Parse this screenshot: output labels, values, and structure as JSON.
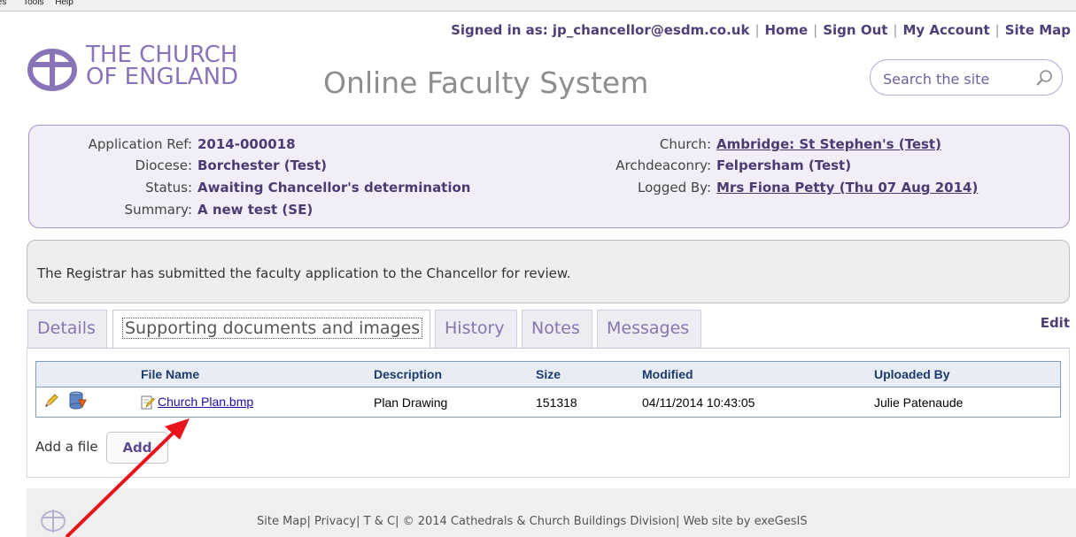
{
  "browser_menu": {
    "items": [
      "tes",
      "Tools",
      "Help"
    ]
  },
  "user_nav": {
    "signed_in": "Signed in as: jp_chancellor@esdm.co.uk",
    "home": "Home",
    "sign_out": "Sign Out",
    "my_account": "My Account",
    "site_map": "Site Map"
  },
  "logo": {
    "line1": "THE CHURCH",
    "line2": "OF ENGLAND"
  },
  "site_title": "Online Faculty System",
  "search": {
    "placeholder": "Search the site",
    "icon": "search-icon"
  },
  "application": {
    "ref_label": "Application Ref:",
    "ref": "2014-000018",
    "diocese_label": "Diocese:",
    "diocese": "Borchester (Test)",
    "status_label": "Status:",
    "status": "Awaiting Chancellor's determination",
    "summary_label": "Summary:",
    "summary": "A new test (SE)",
    "church_label": "Church:",
    "church": "Ambridge: St Stephen's (Test)",
    "archdeaconry_label": "Archdeaconry:",
    "archdeaconry": "Felpersham (Test)",
    "logged_by_label": "Logged By:",
    "logged_by": "Mrs Fiona Petty (Thu 07 Aug 2014)"
  },
  "message": "The Registrar has submitted the faculty application to the Chancellor for review.",
  "tabs": [
    {
      "label": "Details"
    },
    {
      "label": "Supporting documents and images"
    },
    {
      "label": "History"
    },
    {
      "label": "Notes"
    },
    {
      "label": "Messages"
    }
  ],
  "edit_label": "Edit",
  "file_table": {
    "headers": [
      "File Name",
      "Description",
      "Size",
      "Modified",
      "Uploaded By"
    ],
    "rows": [
      {
        "file_name": "Church Plan.bmp",
        "description": "Plan Drawing",
        "size": "151318",
        "modified": "04/11/2014 10:43:05",
        "uploaded_by": "Julie Patenaude"
      }
    ]
  },
  "add_file": {
    "label": "Add a file",
    "button": "Add"
  },
  "footer": {
    "site_map": "Site Map",
    "privacy": "Privacy",
    "terms": "T & C",
    "copyright": "© 2014 Cathedrals & Church Buildings Division",
    "credit": "Web site by exeGesIS"
  },
  "colors": {
    "brand_purple": "#8a74b9",
    "annotation_arrow": "#e8141b"
  }
}
